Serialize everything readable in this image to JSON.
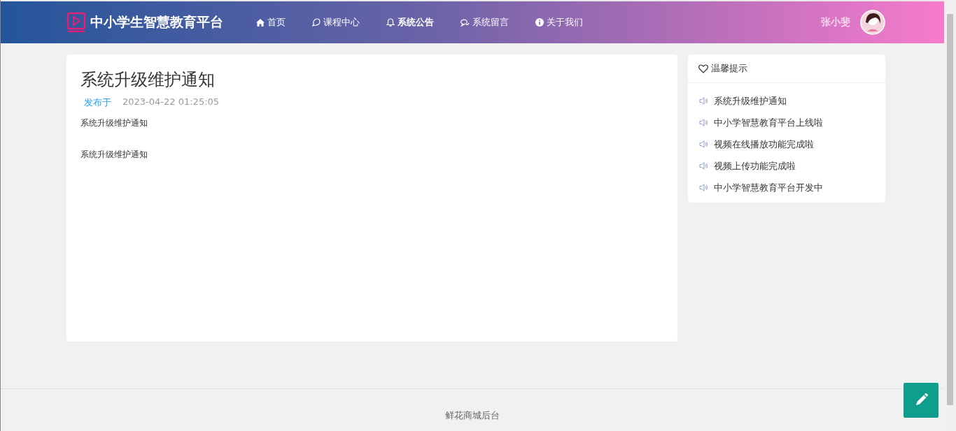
{
  "header": {
    "brand": "中小学生智慧教育平台",
    "nav": [
      {
        "label": "首页",
        "kind": "home",
        "selected": false
      },
      {
        "label": "课程中心",
        "kind": "chat",
        "selected": false
      },
      {
        "label": "系统公告",
        "kind": "bell",
        "selected": true
      },
      {
        "label": "系统留言",
        "kind": "comments",
        "selected": false
      },
      {
        "label": "关于我们",
        "kind": "info",
        "selected": false
      }
    ],
    "user": "张小斐"
  },
  "article": {
    "title": "系统升级维护通知",
    "published_label": "发布于",
    "date": "2023-04-22 01:25:05",
    "paragraphs": [
      "系统升级维护通知",
      "系统升级维护通知"
    ]
  },
  "tips": {
    "title": "温馨提示",
    "items": [
      "系统升级维护通知",
      "中小学智慧教育平台上线啦",
      "视频在线播放功能完成啦",
      "视频上传功能完成啦",
      "中小学智慧教育平台开发中"
    ]
  },
  "footer": "鲜花商城后台"
}
